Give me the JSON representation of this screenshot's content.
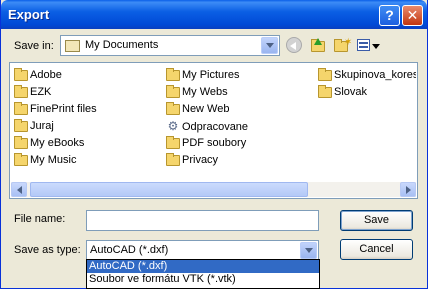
{
  "window": {
    "title": "Export",
    "help_label": "?",
    "close_label": "✕"
  },
  "save_in": {
    "label": "Save in:",
    "value": "My Documents"
  },
  "toolbar": {
    "icons": [
      "back-icon",
      "up-folder-icon",
      "new-folder-icon",
      "views-menu-icon"
    ]
  },
  "files": {
    "col1": [
      "Adobe",
      "EZK",
      "FinePrint files",
      "Juraj",
      "My eBooks",
      "My Music"
    ],
    "col2": [
      "My Pictures",
      "My Webs",
      "New Web",
      "Odpracovane",
      "PDF soubory",
      "Privacy"
    ],
    "col3": [
      "Skupinova_korespondence",
      "Slovak"
    ]
  },
  "file_name": {
    "label": "File name:",
    "value": ""
  },
  "save_as_type": {
    "label": "Save as type:",
    "value": "AutoCAD (*.dxf)",
    "options": [
      "AutoCAD (*.dxf)",
      "Soubor ve formátu VTK (*.vtk)"
    ]
  },
  "buttons": {
    "save": "Save",
    "cancel": "Cancel"
  }
}
